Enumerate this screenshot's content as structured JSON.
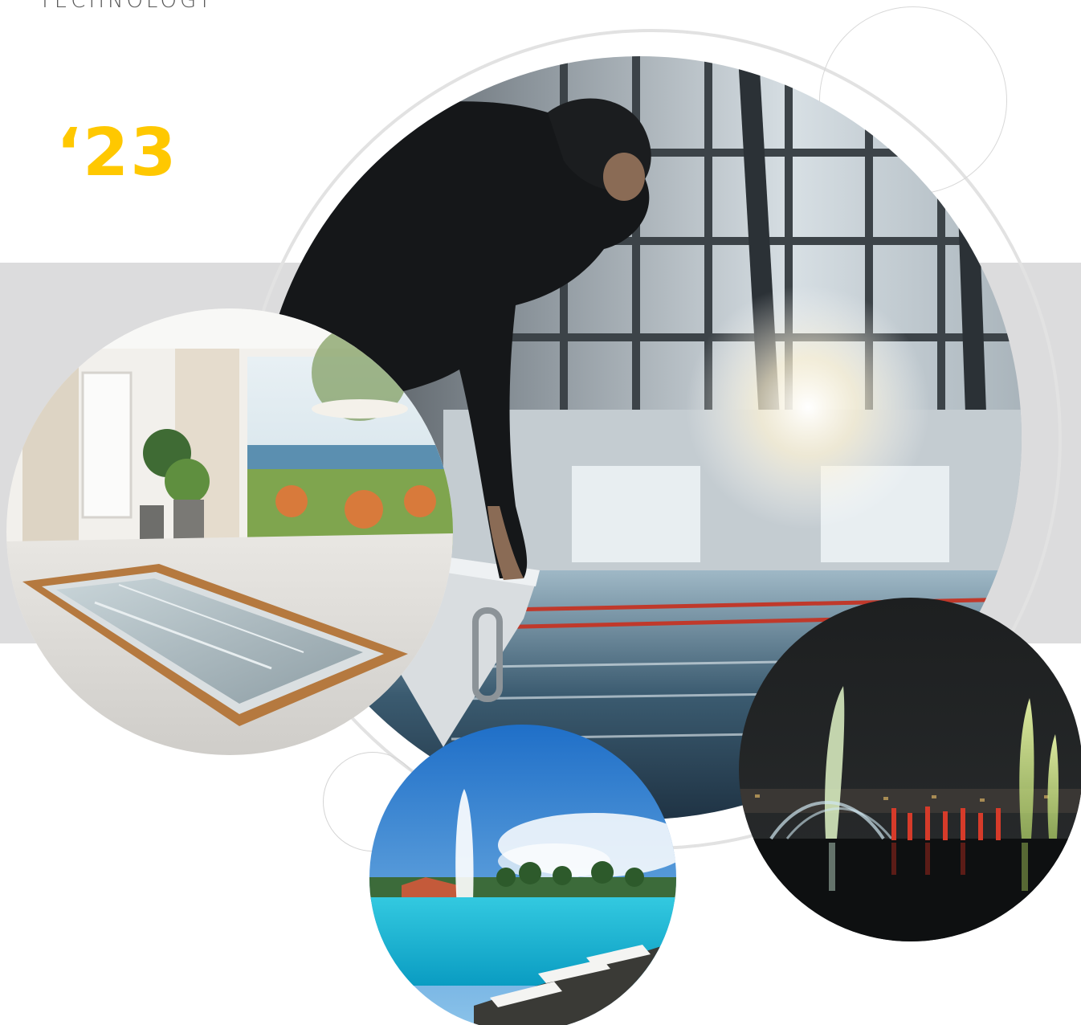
{
  "header": {
    "brand_word": "TECHNOLOGY",
    "year": "‘23"
  },
  "colors": {
    "accent_yellow": "#ffc800",
    "band_gray": "#dcdcdd",
    "ring_gray": "#e2e2e2"
  },
  "photos": [
    {
      "name": "swimmer-on-starting-block-photo"
    },
    {
      "name": "indoor-stainless-pool-photo"
    },
    {
      "name": "resort-pool-fountain-photo"
    },
    {
      "name": "night-lake-fountain-show-photo"
    }
  ]
}
